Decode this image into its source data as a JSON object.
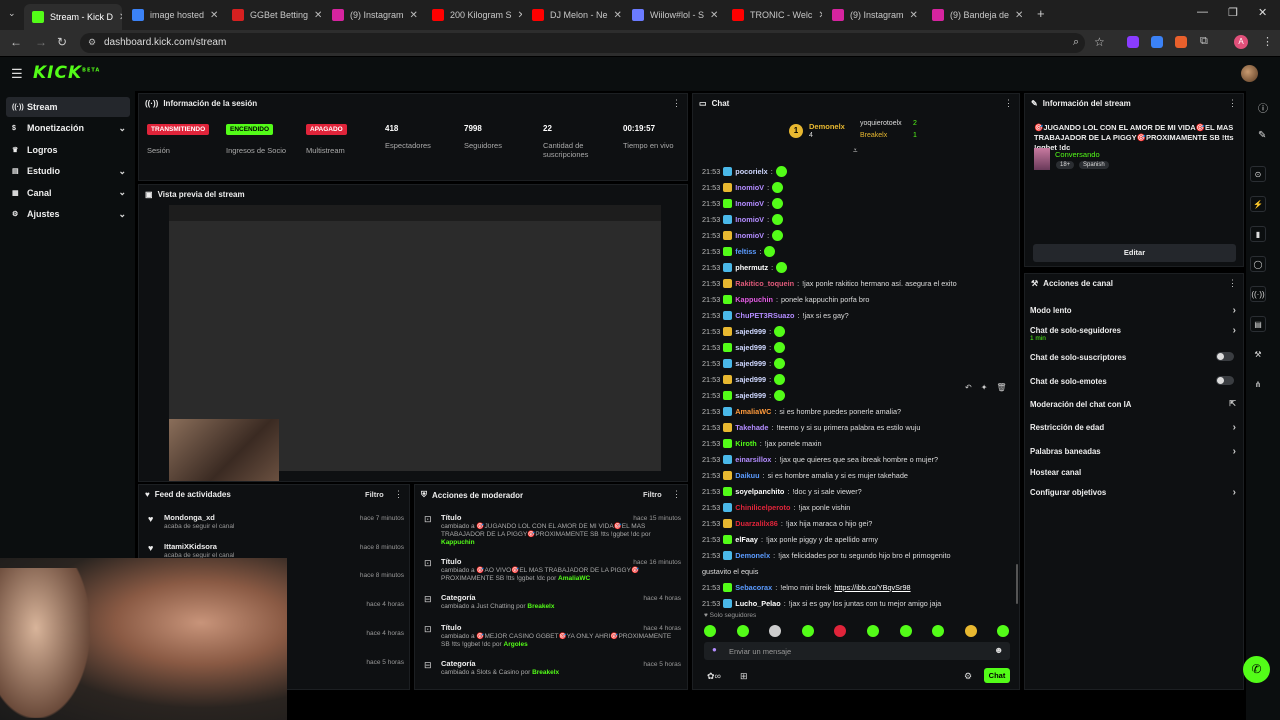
{
  "browser": {
    "tabs": [
      {
        "label": "Stream - Kick D",
        "color": "#53fc18",
        "active": true
      },
      {
        "label": "image hosted",
        "color": "#3b82f6"
      },
      {
        "label": "GGBet Betting",
        "color": "#d62020"
      },
      {
        "label": "(9) Instagram",
        "color": "#d6249f"
      },
      {
        "label": "200 Kilogram S",
        "color": "#ff0000"
      },
      {
        "label": "DJ Melon - Ne",
        "color": "#ff0000"
      },
      {
        "label": "Wiilow#lol - S",
        "color": "#6b7bff"
      },
      {
        "label": "TRONIC - Welc",
        "color": "#ff0000"
      },
      {
        "label": "(9) Instagram",
        "color": "#d6249f"
      },
      {
        "label": "(9) Bandeja de",
        "color": "#d6249f"
      }
    ],
    "url": "dashboard.kick.com/stream",
    "profile_initial": "A"
  },
  "kick": {
    "logo": "KICK",
    "logo_sup": "BETA"
  },
  "sidebar": {
    "items": [
      {
        "label": "Stream",
        "icon": "broadcast-icon",
        "active": true
      },
      {
        "label": "Monetización",
        "icon": "dollar-icon",
        "chevron": true
      },
      {
        "label": "Logros",
        "icon": "trophy-icon"
      },
      {
        "label": "Estudio",
        "icon": "studio-icon",
        "chevron": true
      },
      {
        "label": "Canal",
        "icon": "channel-icon",
        "chevron": true
      },
      {
        "label": "Ajustes",
        "icon": "gear-icon",
        "chevron": true
      }
    ]
  },
  "session": {
    "title": "Información de la sesión",
    "stats": [
      {
        "badge": "TRANSMITIENDO",
        "badge_color": "#e0243a",
        "label": "Sesión"
      },
      {
        "badge": "ENCENDIDO",
        "badge_color": "#53fc18",
        "label": "Ingresos de Socio"
      },
      {
        "badge": "APAGADO",
        "badge_color": "#e0243a",
        "label": "Multistream"
      },
      {
        "value": "418",
        "label": "Espectadores"
      },
      {
        "value": "7998",
        "label": "Seguidores"
      },
      {
        "value": "22",
        "label": "Cantidad de suscripciones"
      },
      {
        "value": "00:19:57",
        "label": "Tiempo en vivo"
      }
    ]
  },
  "preview": {
    "title": "Vista previa del stream"
  },
  "feed": {
    "title": "Feed de actividades",
    "filter": "Filtro",
    "items": [
      {
        "name": "Mondonga_xd",
        "sub": "acaba de seguir el canal",
        "time": "hace 7 minutos"
      },
      {
        "name": "IttamiXKidsora",
        "sub": "acaba de seguir el canal",
        "time": "hace 8 minutos"
      },
      {
        "name": "",
        "sub": "",
        "time": "hace 8 minutos"
      },
      {
        "name": "",
        "sub": "",
        "time": "hace 4 horas"
      },
      {
        "name": "",
        "sub": "",
        "time": "hace 4 horas"
      },
      {
        "name": "",
        "sub": "",
        "time": "hace 5 horas"
      }
    ]
  },
  "modactions": {
    "title": "Acciones de moderador",
    "filter": "Filtro",
    "items": [
      {
        "title": "Título",
        "desc": "cambiado a 🎯JUGANDO LOL CON EL AMOR DE MI VIDA🎯EL MAS TRABAJADOR DE LA PIGGY🎯PROXIMAMENTE SB !tts !ggbet !dc por",
        "by": "Kappuchin",
        "time": "hace 15 minutos"
      },
      {
        "title": "Título",
        "desc": "cambiado a 🎯AO VIVO🎯EL MAS TRABAJADOR DE LA PIGGY🎯PROXIMAMENTE SB !tts !ggbet !dc por",
        "by": "AmaliaWC",
        "time": "hace 16 minutos"
      },
      {
        "title": "Categoría",
        "desc": "cambiado a Just Chatting por",
        "by": "Breakelx",
        "time": "hace 4 horas"
      },
      {
        "title": "Título",
        "desc": "cambiado a 🎯MEJOR CASINO GGBET🎯YA ONLY AHRI🎯PROXIMAMENTE SB !tts !ggbet !dc por",
        "by": "Argoles",
        "time": "hace 4 horas"
      },
      {
        "title": "Categoría",
        "desc": "cambiado a Slots & Casino por",
        "by": "Breakelx",
        "time": "hace 5 horas"
      }
    ]
  },
  "chat": {
    "title": "Chat",
    "top_gifter": {
      "name": "Demonelx",
      "count": "4",
      "rank": "1"
    },
    "gifters": [
      {
        "name": "yoquierotoelx",
        "count": "2"
      },
      {
        "name": "Breakelx",
        "count": "1"
      }
    ],
    "messages": [
      {
        "time": "21:53",
        "user": "pocorielx",
        "color": "#cfd8ff",
        "text": "",
        "emote": true
      },
      {
        "time": "21:53",
        "user": "InomioV",
        "color": "#b38cff",
        "text": "",
        "emote": true
      },
      {
        "time": "21:53",
        "user": "InomioV",
        "color": "#b38cff",
        "text": "",
        "emote": true
      },
      {
        "time": "21:53",
        "user": "InomioV",
        "color": "#b38cff",
        "text": "",
        "emote": true
      },
      {
        "time": "21:53",
        "user": "InomioV",
        "color": "#b38cff",
        "text": "",
        "emote": true
      },
      {
        "time": "21:53",
        "user": "feltiss",
        "color": "#5b9bff",
        "text": "",
        "emote": true
      },
      {
        "time": "21:53",
        "user": "phermutz",
        "color": "#ffffff",
        "text": "",
        "emote": true
      },
      {
        "time": "21:53",
        "user": "Rakitico_toquein",
        "color": "#e05a7a",
        "text": "!jax ponle rakitico hermano así. asegura el exito"
      },
      {
        "time": "21:53",
        "user": "Kappuchin",
        "color": "#e05ae0",
        "text": "ponele kappuchin porfa bro"
      },
      {
        "time": "21:53",
        "user": "ChuPET3RSuazo",
        "color": "#b38cff",
        "text": "!jax si es gay?"
      },
      {
        "time": "21:53",
        "user": "sajed999",
        "color": "#cfd8ff",
        "text": "",
        "emote": true
      },
      {
        "time": "21:53",
        "user": "sajed999",
        "color": "#cfd8ff",
        "text": "",
        "emote": true
      },
      {
        "time": "21:53",
        "user": "sajed999",
        "color": "#cfd8ff",
        "text": "",
        "emote": true
      },
      {
        "time": "21:53",
        "user": "sajed999",
        "color": "#cfd8ff",
        "text": "",
        "emote": true
      },
      {
        "time": "21:53",
        "user": "sajed999",
        "color": "#cfd8ff",
        "text": "",
        "emote": true
      },
      {
        "time": "21:53",
        "user": "AmaliaWC",
        "color": "#ff9a3c",
        "text": "si es hombre puedes ponerle amalia?"
      },
      {
        "time": "21:53",
        "user": "Takehade",
        "color": "#b38cff",
        "text": "!teemo y si su primera palabra es estilo wuju"
      },
      {
        "time": "21:53",
        "user": "Kiroth",
        "color": "#53fc18",
        "text": "!jax ponele maxin"
      },
      {
        "time": "21:53",
        "user": "einarsillox",
        "color": "#b38cff",
        "text": "!jax que quieres que sea ibreak hombre o mujer?"
      },
      {
        "time": "21:53",
        "user": "Daikuu",
        "color": "#5b9bff",
        "text": "si es hombre amalia y si es mujer takehade"
      },
      {
        "time": "21:53",
        "user": "soyelpanchito",
        "color": "#ffffff",
        "text": "!doc y si sale viewer?"
      },
      {
        "time": "21:53",
        "user": "Chinilicelperoto",
        "color": "#e0243a",
        "text": "!jax ponle vishin"
      },
      {
        "time": "21:53",
        "user": "Duarzalilx86",
        "color": "#e0243a",
        "text": "!jax hija maraca o hijo gei?"
      },
      {
        "time": "21:53",
        "user": "elFaay",
        "color": "#ffffff",
        "text": "!jax ponle piggy y de apellido army"
      },
      {
        "time": "21:53",
        "user": "Demonelx",
        "color": "#5b9bff",
        "text": "!jax felicidades por tu segundo hijo bro el primogenito"
      },
      {
        "time": "",
        "user": "",
        "color": "#dddddd",
        "text": "gustavito el equis"
      },
      {
        "time": "21:53",
        "user": "Sebacorax",
        "color": "#5b9bff",
        "text": "!elmo mini breik",
        "link": "https://ibb.co/YBqvSr98"
      },
      {
        "time": "21:53",
        "user": "Lucho_Pelao",
        "color": "#ffffff",
        "text": "!jax si es gay los juntas con tu mejor amigo jaja"
      }
    ],
    "followers_only": "Solo seguidores",
    "input_placeholder": "Enviar un mensaje",
    "send_label": "Chat"
  },
  "stream_info": {
    "title": "Información del stream",
    "stream_title": "🎯JUGANDO LOL CON EL AMOR DE MI VIDA🎯EL MAS TRABAJADOR DE LA PIGGY🎯PROXIMAMENTE SB !tts !ggbet !dc",
    "category": "Conversando",
    "tags": [
      "18+",
      "Spanish"
    ],
    "edit_label": "Editar"
  },
  "channel_actions": {
    "title": "Acciones de canal",
    "items": [
      {
        "label": "Modo lento",
        "type": "chevron"
      },
      {
        "label": "Chat de solo-seguidores",
        "sub": "1 min",
        "type": "chevron"
      },
      {
        "label": "Chat de solo-suscriptores",
        "type": "toggle"
      },
      {
        "label": "Chat de solo-emotes",
        "type": "toggle"
      },
      {
        "label": "Moderación del chat con IA",
        "type": "external"
      },
      {
        "label": "Restricción de edad",
        "type": "chevron"
      },
      {
        "label": "Palabras baneadas",
        "type": "chevron"
      },
      {
        "label": "Hostear canal",
        "type": "none"
      },
      {
        "label": "Configurar objetivos",
        "type": "chevron"
      }
    ]
  },
  "colors": {
    "brand": "#53fc18",
    "live": "#e0243a",
    "panel": "#0e1012"
  }
}
